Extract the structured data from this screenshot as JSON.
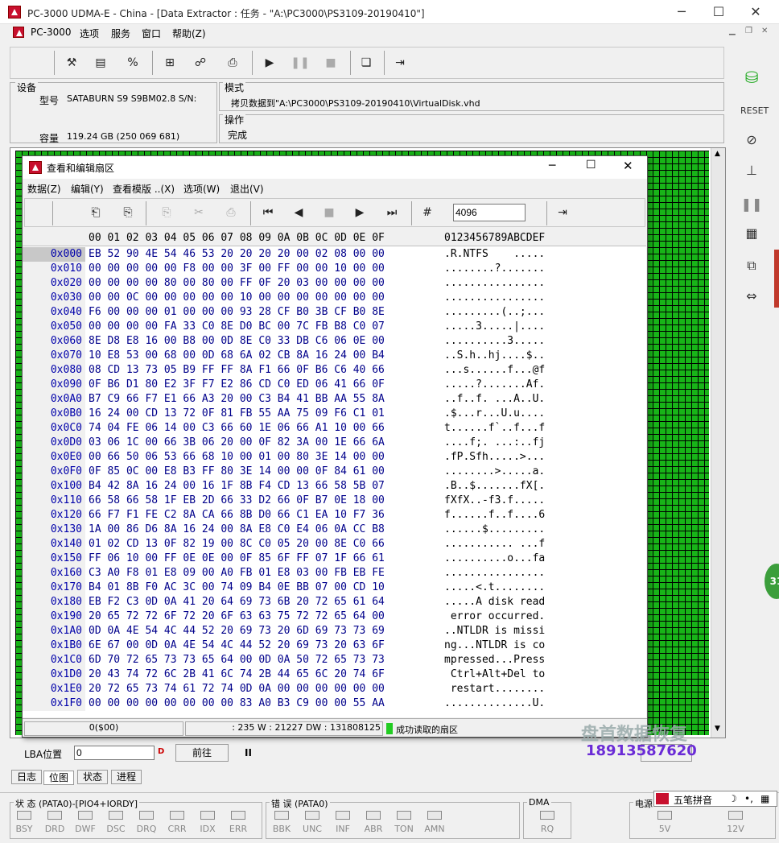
{
  "app": {
    "title": "PC-3000 UDMA-E - China - [Data Extractor : 任务 - \"A:\\PC3000\\PS3109-20190410\"]"
  },
  "menu": [
    "PC-3000",
    "选项",
    "服务",
    "窗口",
    "帮助(Z)"
  ],
  "device": {
    "group_label": "设备",
    "model_label": "型号",
    "model_value": "SATABURN   S9 S9BM02.8 S/N:",
    "capacity_label": "容量",
    "capacity_value": "119.24 GB (250 069 681)"
  },
  "mode": {
    "group_label": "模式",
    "value": "拷贝数据到\"A:\\PC3000\\PS3109-20190410\\VirtualDisk.vhd"
  },
  "operation": {
    "group_label": "操作",
    "value": "完成"
  },
  "hexwin": {
    "title": "查看和编辑扇区",
    "menu": [
      "数据(Z)",
      "编辑(Y)",
      "查看模版 ..(X)",
      "选项(W)",
      "退出(V)"
    ],
    "sector_input": "4096",
    "col_header": "00 01 02 03 04 05 06 07 08 09 0A 0B 0C 0D 0E 0F",
    "ascii_header": "0123456789ABCDEF"
  },
  "rows": [
    {
      "off": "0x000",
      "hex": "EB 52 90 4E 54 46 53 20 20 20 20 00 02 08 00 00",
      "asc": ".R.NTFS    ....."
    },
    {
      "off": "0x010",
      "hex": "00 00 00 00 00 F8 00 00 3F 00 FF 00 00 10 00 00",
      "asc": "........?......."
    },
    {
      "off": "0x020",
      "hex": "00 00 00 00 80 00 80 00 FF 0F 20 03 00 00 00 00",
      "asc": "................"
    },
    {
      "off": "0x030",
      "hex": "00 00 0C 00 00 00 00 00 10 00 00 00 00 00 00 00",
      "asc": "................"
    },
    {
      "off": "0x040",
      "hex": "F6 00 00 00 01 00 00 00 93 28 CF B0 3B CF B0 8E",
      "asc": ".........(..;..."
    },
    {
      "off": "0x050",
      "hex": "00 00 00 00 FA 33 C0 8E D0 BC 00 7C FB B8 C0 07",
      "asc": ".....3.....|...."
    },
    {
      "off": "0x060",
      "hex": "8E D8 E8 16 00 B8 00 0D 8E C0 33 DB C6 06 0E 00",
      "asc": "..........3....."
    },
    {
      "off": "0x070",
      "hex": "10 E8 53 00 68 00 0D 68 6A 02 CB 8A 16 24 00 B4",
      "asc": "..S.h..hj....$.."
    },
    {
      "off": "0x080",
      "hex": "08 CD 13 73 05 B9 FF FF 8A F1 66 0F B6 C6 40 66",
      "asc": "...s......f...@f"
    },
    {
      "off": "0x090",
      "hex": "0F B6 D1 80 E2 3F F7 E2 86 CD C0 ED 06 41 66 0F",
      "asc": ".....?.......Af."
    },
    {
      "off": "0x0A0",
      "hex": "B7 C9 66 F7 E1 66 A3 20 00 C3 B4 41 BB AA 55 8A",
      "asc": "..f..f. ...A..U."
    },
    {
      "off": "0x0B0",
      "hex": "16 24 00 CD 13 72 0F 81 FB 55 AA 75 09 F6 C1 01",
      "asc": ".$...r...U.u...."
    },
    {
      "off": "0x0C0",
      "hex": "74 04 FE 06 14 00 C3 66 60 1E 06 66 A1 10 00 66",
      "asc": "t......f`..f...f"
    },
    {
      "off": "0x0D0",
      "hex": "03 06 1C 00 66 3B 06 20 00 0F 82 3A 00 1E 66 6A",
      "asc": "....f;. ...:..fj"
    },
    {
      "off": "0x0E0",
      "hex": "00 66 50 06 53 66 68 10 00 01 00 80 3E 14 00 00",
      "asc": ".fP.Sfh.....>..."
    },
    {
      "off": "0x0F0",
      "hex": "0F 85 0C 00 E8 B3 FF 80 3E 14 00 00 0F 84 61 00",
      "asc": "........>.....a."
    },
    {
      "off": "0x100",
      "hex": "B4 42 8A 16 24 00 16 1F 8B F4 CD 13 66 58 5B 07",
      "asc": ".B..$.......fX[."
    },
    {
      "off": "0x110",
      "hex": "66 58 66 58 1F EB 2D 66 33 D2 66 0F B7 0E 18 00",
      "asc": "fXfX..-f3.f....."
    },
    {
      "off": "0x120",
      "hex": "66 F7 F1 FE C2 8A CA 66 8B D0 66 C1 EA 10 F7 36",
      "asc": "f......f..f....6"
    },
    {
      "off": "0x130",
      "hex": "1A 00 86 D6 8A 16 24 00 8A E8 C0 E4 06 0A CC B8",
      "asc": "......$........."
    },
    {
      "off": "0x140",
      "hex": "01 02 CD 13 0F 82 19 00 8C C0 05 20 00 8E C0 66",
      "asc": "........... ...f"
    },
    {
      "off": "0x150",
      "hex": "FF 06 10 00 FF 0E 0E 00 0F 85 6F FF 07 1F 66 61",
      "asc": "..........o...fa"
    },
    {
      "off": "0x160",
      "hex": "C3 A0 F8 01 E8 09 00 A0 FB 01 E8 03 00 FB EB FE",
      "asc": "................"
    },
    {
      "off": "0x170",
      "hex": "B4 01 8B F0 AC 3C 00 74 09 B4 0E BB 07 00 CD 10",
      "asc": ".....<.t........"
    },
    {
      "off": "0x180",
      "hex": "EB F2 C3 0D 0A 41 20 64 69 73 6B 20 72 65 61 64",
      "asc": ".....A disk read"
    },
    {
      "off": "0x190",
      "hex": "20 65 72 72 6F 72 20 6F 63 63 75 72 72 65 64 00",
      "asc": " error occurred."
    },
    {
      "off": "0x1A0",
      "hex": "0D 0A 4E 54 4C 44 52 20 69 73 20 6D 69 73 73 69",
      "asc": "..NTLDR is missi"
    },
    {
      "off": "0x1B0",
      "hex": "6E 67 00 0D 0A 4E 54 4C 44 52 20 69 73 20 63 6F",
      "asc": "ng...NTLDR is co"
    },
    {
      "off": "0x1C0",
      "hex": "6D 70 72 65 73 73 65 64 00 0D 0A 50 72 65 73 73",
      "asc": "mpressed...Press"
    },
    {
      "off": "0x1D0",
      "hex": "20 43 74 72 6C 2B 41 6C 74 2B 44 65 6C 20 74 6F",
      "asc": " Ctrl+Alt+Del to"
    },
    {
      "off": "0x1E0",
      "hex": "20 72 65 73 74 61 72 74 0D 0A 00 00 00 00 00 00",
      "asc": " restart........"
    },
    {
      "off": "0x1F0",
      "hex": "00 00 00 00 00 00 00 00 83 A0 B3 C9 00 00 55 AA",
      "asc": "..............U."
    }
  ],
  "statusbar": {
    "pos": "0($00)",
    "stats": ": 235 W : 21227 DW : 131808125",
    "msg": "成功读取的扇区"
  },
  "lba": {
    "label": "LBA位置",
    "value": "0",
    "go_label": "前往",
    "pause": "II",
    "left_btn": "D"
  },
  "tabs": [
    "日志",
    "位图",
    "状态",
    "进程"
  ],
  "status_panel": {
    "label": "状 态 (PATA0)-[PIO4+IORDY]",
    "leds": [
      "BSY",
      "DRD",
      "DWF",
      "DSC",
      "DRQ",
      "CRR",
      "IDX",
      "ERR"
    ]
  },
  "error_panel": {
    "label": "错 误 (PATA0)",
    "leds": [
      "BBK",
      "UNC",
      "INF",
      "ABR",
      "TON",
      "AMN"
    ]
  },
  "dma_panel": {
    "label": "DMA",
    "leds": [
      "RQ"
    ]
  },
  "power_panel": {
    "label": "电源",
    "leds": [
      "5V",
      "12V"
    ]
  },
  "ime": {
    "label": "五笔拼音"
  },
  "watermark": {
    "line1": "盘首数据恢复",
    "line2": "18913587620"
  },
  "side_badge": "31",
  "side_labels": {
    "reset": "RESET"
  }
}
